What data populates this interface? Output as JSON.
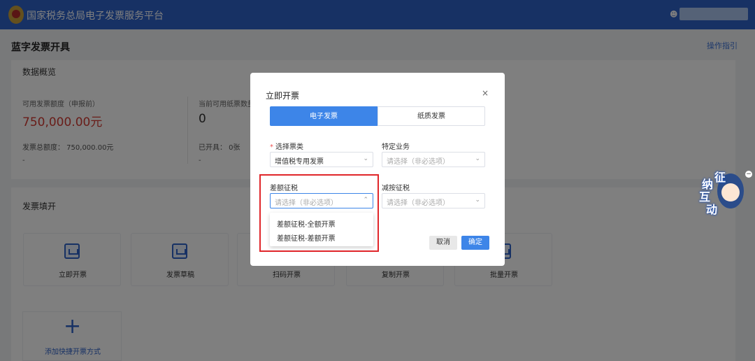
{
  "app": {
    "title": "国家税务总局电子发票服务平台",
    "user_icon": "user-icon"
  },
  "page": {
    "title": "蓝字发票开具",
    "guide_link": "操作指引"
  },
  "overview": {
    "title": "数据概览",
    "stats": [
      {
        "label": "可用发票额度（申报前）",
        "value": "750,000.00元",
        "sub": "发票总额度：  750,000.00元",
        "sub2": "-"
      },
      {
        "label": "当前可用纸票数量",
        "value": "0",
        "sub": "已开具：  0张",
        "sub2": "-"
      }
    ]
  },
  "fill": {
    "title": "发票填开",
    "tiles": [
      {
        "label": "立即开票",
        "icon": "invoice-icon"
      },
      {
        "label": "发票草稿",
        "icon": "draft-icon"
      },
      {
        "label": "扫码开票",
        "icon": "scan-icon"
      },
      {
        "label": "复制开票",
        "icon": "copy-icon"
      },
      {
        "label": "批量开票",
        "icon": "batch-icon"
      }
    ],
    "add_label": "添加快捷开票方式",
    "add_icon": "plus-icon"
  },
  "mascot": {
    "chars": [
      "征",
      "纳",
      "互",
      "动"
    ],
    "minimize": "−"
  },
  "modal": {
    "title": "立即开票",
    "close": "×",
    "tabs": [
      "电子发票",
      "纸质发票"
    ],
    "fields": {
      "ticket_type": {
        "label": "选择票类",
        "value": "增值税专用发票"
      },
      "special": {
        "label": "特定业务",
        "placeholder": "请选择（非必选项）"
      },
      "diff_tax": {
        "label": "差额征税",
        "placeholder": "请选择（非必选项）"
      },
      "reduced_tax": {
        "label": "减按征税",
        "placeholder": "请选择（非必选项）"
      }
    },
    "dropdown_options": [
      "差额征税-全额开票",
      "差额征税-差额开票"
    ],
    "cancel": "取消",
    "ok": "确定"
  },
  "colors": {
    "header": "#2f62c8",
    "primary": "#3d85e8",
    "danger": "#e0262a",
    "amount": "#d33b32"
  }
}
